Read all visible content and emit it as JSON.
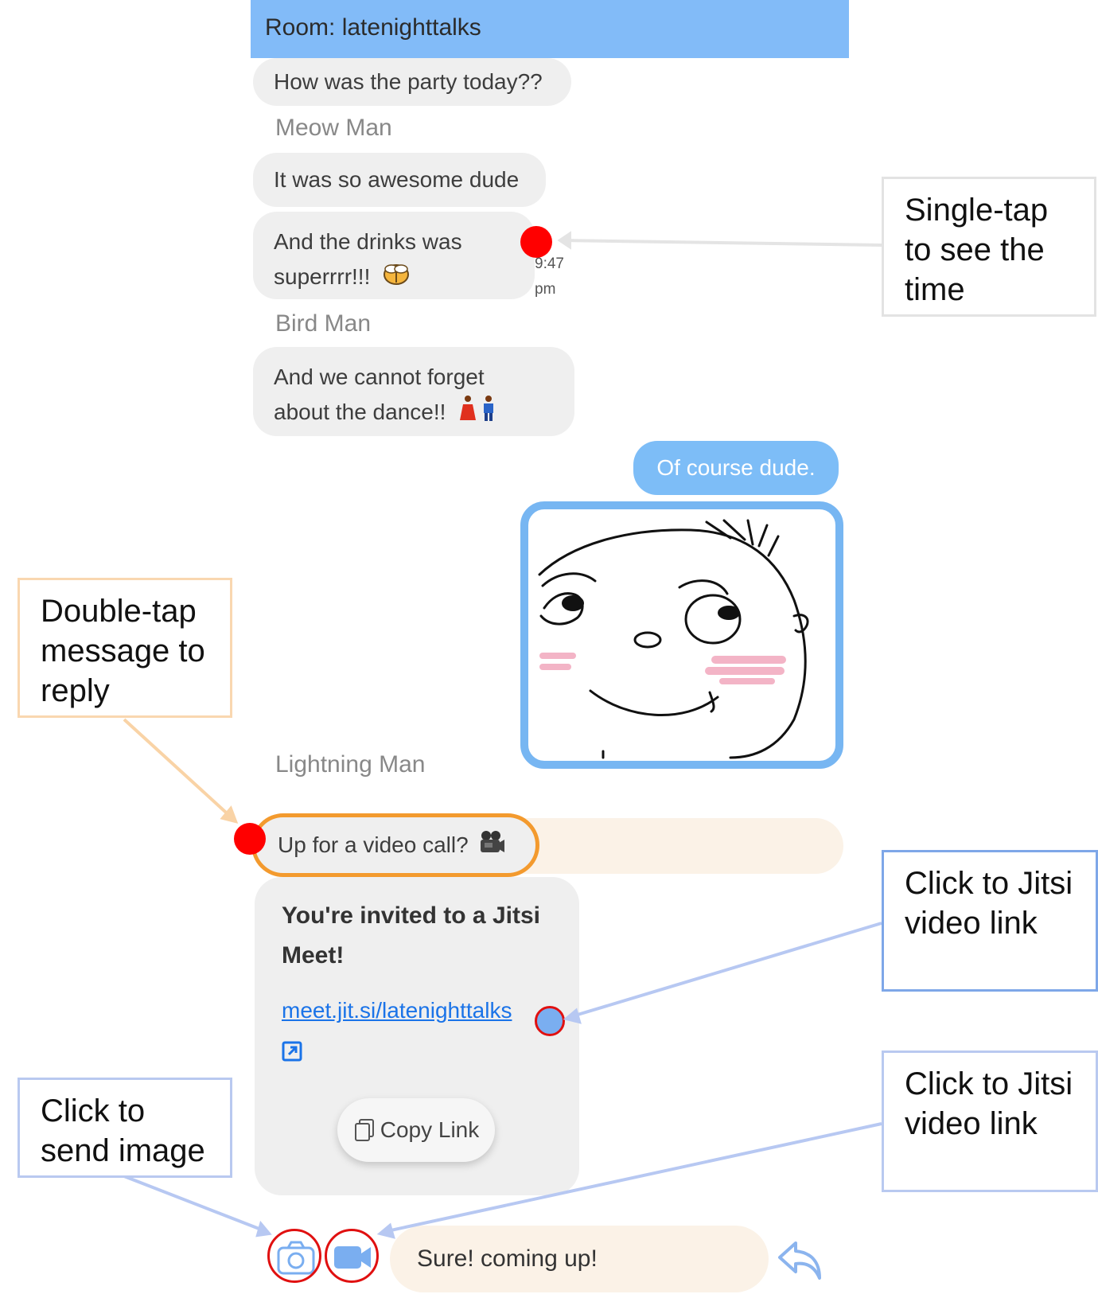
{
  "room": {
    "title": "Room: latenighttalks"
  },
  "messages": {
    "m1": "How was the party today??",
    "sender_meow": "Meow Man",
    "m2": "It was so awesome dude",
    "m3_line1": "And the drinks was",
    "m3_line2": "superrrr!!!",
    "m3_time_line1": "9:47",
    "m3_time_line2": "pm",
    "sender_bird": "Bird Man",
    "m4_line1": "And we cannot forget",
    "m4_line2": "about the dance!!",
    "m5_mine": "Of course dude.",
    "sender_lightning": "Lightning Man",
    "m6": "Up for a video call?"
  },
  "jitsi": {
    "title": "You're invited to a Jitsi Meet!",
    "link": "meet.jit.si/latenighttalks",
    "copy_label": "Copy Link"
  },
  "input": {
    "value": "Sure! coming up!"
  },
  "annotations": {
    "single_tap": "Single-tap to see the time",
    "double_tap": "Double-tap message to reply",
    "jitsi_link_1": "Click to Jitsi video link",
    "send_image": "Click to send image",
    "jitsi_link_2": "Click to Jitsi video link"
  },
  "icons": {
    "beer": "beer-mugs-icon",
    "dance": "dancers-icon",
    "video_camera": "movie-camera-icon",
    "external": "external-link-icon",
    "copy": "copy-icon",
    "camera": "camera-icon",
    "video": "video-call-icon",
    "send": "reply-arrow-icon"
  },
  "colors": {
    "header": "#82bbf8",
    "own_bubble": "#7dbdf7",
    "other_bubble": "#efefef",
    "reply_highlight": "#f39a2e",
    "link": "#1a73e8",
    "marker": "#ff0000"
  }
}
